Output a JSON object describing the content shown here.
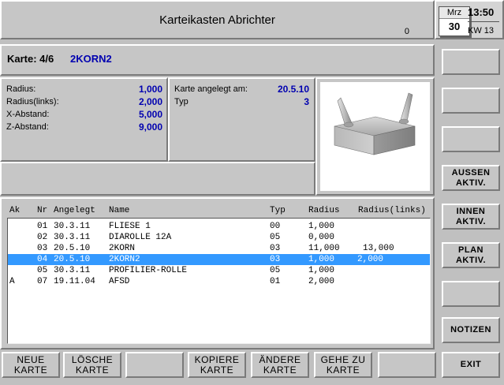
{
  "header": {
    "title": "Karteikasten Abrichter",
    "counter": "0"
  },
  "date": {
    "month": "Mrz",
    "day": "30",
    "time": "13:50",
    "week": "KW 13"
  },
  "card": {
    "label": "Karte: 4/6",
    "name": "2KORN2"
  },
  "props_left": [
    {
      "label": "Radius:",
      "value": "1,000"
    },
    {
      "label": "Radius(links):",
      "value": "2,000"
    },
    {
      "label": "X-Abstand:",
      "value": "5,000"
    },
    {
      "label": "Z-Abstand:",
      "value": "9,000"
    }
  ],
  "props_mid": [
    {
      "label": "Karte angelegt am:",
      "value": "20.5.10"
    },
    {
      "label": "Typ",
      "value": "3"
    }
  ],
  "table": {
    "headers": [
      "Ak",
      "Nr",
      "Angelegt",
      "Name",
      "Typ",
      "Radius",
      "Radius(links)"
    ],
    "rows": [
      {
        "ak": "",
        "nr": "01",
        "date": "30.3.11",
        "name": "FLIESE 1",
        "typ": "00",
        "radius": "1,000",
        "radius_links": "",
        "selected": false
      },
      {
        "ak": "",
        "nr": "02",
        "date": "30.3.11",
        "name": "DIAROLLE 12A",
        "typ": "05",
        "radius": "0,000",
        "radius_links": "",
        "selected": false
      },
      {
        "ak": "",
        "nr": "03",
        "date": "20.5.10",
        "name": "2KORN",
        "typ": "03",
        "radius": "11,000",
        "radius_links": "13,000",
        "selected": false
      },
      {
        "ak": "",
        "nr": "04",
        "date": "20.5.10",
        "name": "2KORN2",
        "typ": "03",
        "radius": "1,000",
        "radius_links": "2,000",
        "selected": true
      },
      {
        "ak": "",
        "nr": "05",
        "date": "30.3.11",
        "name": "PROFILIER-ROLLE",
        "typ": "05",
        "radius": "1,000",
        "radius_links": "",
        "selected": false
      },
      {
        "ak": "A",
        "nr": "07",
        "date": "19.11.04",
        "name": "AFSD",
        "typ": "01",
        "radius": "2,000",
        "radius_links": "",
        "selected": false
      }
    ]
  },
  "right_buttons": [
    {
      "label": ""
    },
    {
      "label": ""
    },
    {
      "label": ""
    },
    {
      "label": "AUSSEN\nAKTIV."
    },
    {
      "label": "INNEN\nAKTIV."
    },
    {
      "label": "PLAN\nAKTIV."
    },
    {
      "label": ""
    },
    {
      "label": "NOTIZEN"
    },
    {
      "label": "EXIT"
    }
  ],
  "bottom_buttons": [
    {
      "label": "NEUE\nKARTE"
    },
    {
      "label": "LÖSCHE\nKARTE"
    },
    {
      "label": ""
    },
    {
      "label": "KOPIERE\nKARTE"
    },
    {
      "label": "ÄNDERE\nKARTE"
    },
    {
      "label": "GEHE ZU\nKARTE"
    },
    {
      "label": ""
    }
  ]
}
